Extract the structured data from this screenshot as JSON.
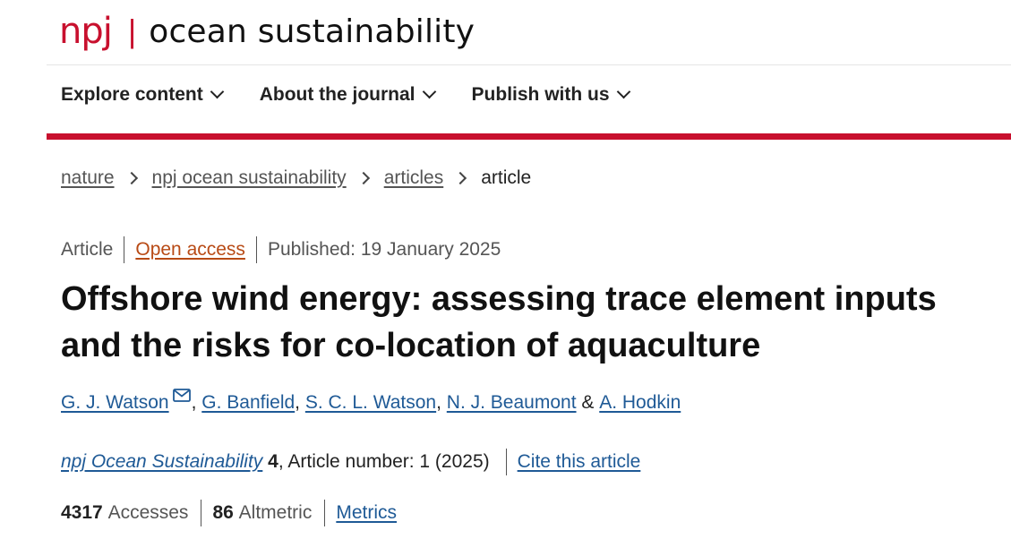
{
  "header": {
    "brand_mark": "npj",
    "separator": "|",
    "journal_name": "ocean sustainability"
  },
  "nav": [
    {
      "label": "Explore content"
    },
    {
      "label": "About the journal"
    },
    {
      "label": "Publish with us"
    }
  ],
  "breadcrumb": [
    {
      "label": "nature"
    },
    {
      "label": "npj ocean sustainability"
    },
    {
      "label": "articles"
    },
    {
      "label": "article"
    }
  ],
  "article_meta": {
    "type": "Article",
    "open_access": "Open access",
    "published": "Published: 19 January 2025"
  },
  "title": "Offshore wind energy: assessing trace element inputs and the risks for co-location of aquaculture",
  "authors": {
    "a1": "G. J. Watson",
    "a2": "G. Banfield",
    "a3": "S. C. L. Watson",
    "a4": "N. J. Beaumont",
    "a5": "A. Hodkin",
    "comma": ", ",
    "amp": " & "
  },
  "citation": {
    "journal": "npj Ocean Sustainability",
    "volume": "4",
    "article_number": ", Article number: 1 (2025)",
    "cite_link": "Cite this article"
  },
  "metrics": {
    "accesses_value": "4317",
    "accesses_label": "Accesses",
    "altmetric_value": "86",
    "altmetric_label": "Altmetric",
    "metrics_link": "Metrics"
  },
  "colors": {
    "brand_red": "#c8102e",
    "link_blue": "#1f5a96",
    "open_access_orange": "#b84a15"
  },
  "icons": {
    "nav_chevron": "chevron-down-icon",
    "crumb_sep": "chevron-right-icon",
    "mail": "mail-icon"
  }
}
